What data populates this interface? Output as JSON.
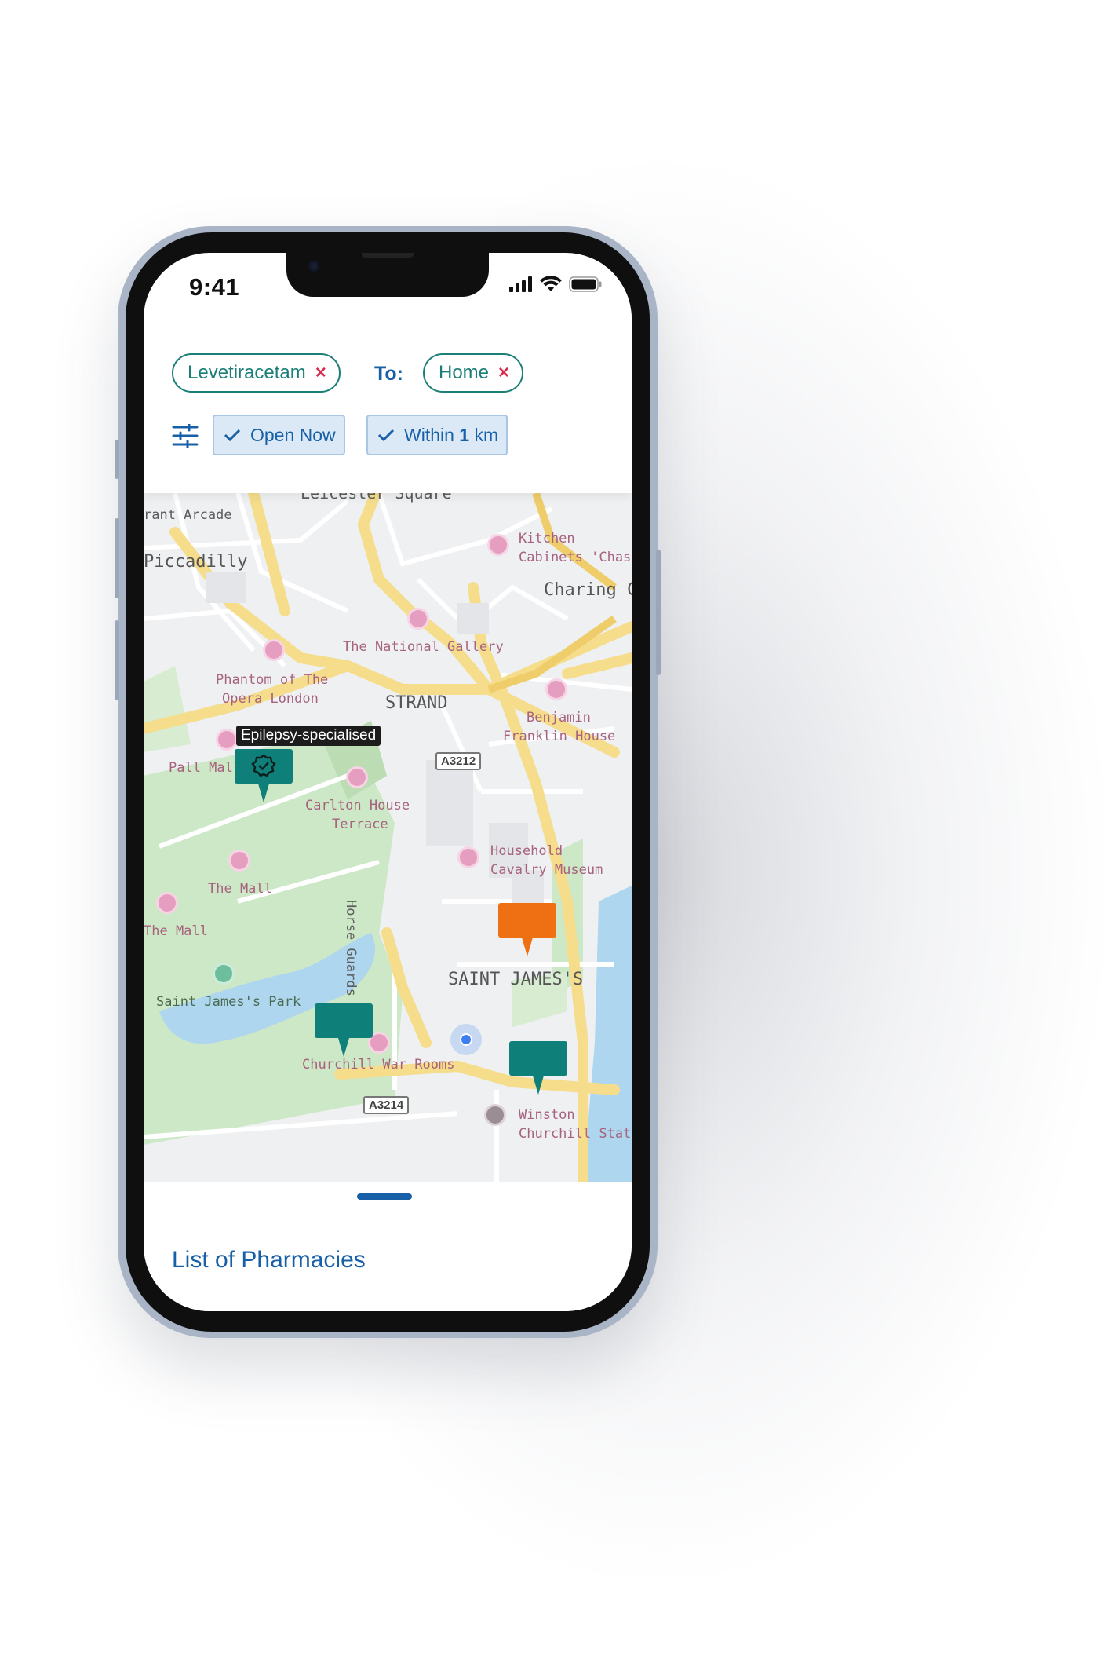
{
  "status_bar": {
    "time": "9:41"
  },
  "search": {
    "medication_chip": "Levetiracetam",
    "to_label": "To:",
    "destination_chip": "Home",
    "remove_symbol": "×"
  },
  "filters": {
    "open_now": "Open Now",
    "within_prefix": "Within",
    "within_value": "1",
    "within_unit": "km"
  },
  "map": {
    "labels": {
      "leicester_square": "Leicester Square",
      "arcade": "rant Arcade",
      "piccadilly": "Piccadilly",
      "kitchen_1": "Kitchen",
      "kitchen_2": "Cabinets 'Chas'",
      "charing": "Charing Cr",
      "national_gallery": "The National Gallery",
      "phantom_1": "Phantom of The",
      "phantom_2": "Opera London",
      "strand": "STRAND",
      "benjamin_1": "Benjamin",
      "benjamin_2": "Franklin House",
      "pall_mall": "Pall Mall",
      "a3212": "A3212",
      "carlton_1": "Carlton House",
      "carlton_2": "Terrace",
      "horse_guards": "Horse Guards Road",
      "household_1": "Household",
      "household_2": "Cavalry Museum",
      "the_mall_1": "The Mall",
      "the_mall_2": "The Mall",
      "saint_james": "SAINT JAMES'S",
      "st_james_park": "Saint James's Park",
      "churchill_war": "Churchill War Rooms",
      "a3214": "A3214",
      "winston_1": "Winston",
      "winston_2": "Churchill Statu"
    },
    "tooltip": "Epilepsy-specialised",
    "marker_colors": {
      "standard": "#0f7f7a",
      "highlight": "#ef7012"
    }
  },
  "sheet": {
    "title": "List of Pharmacies"
  }
}
